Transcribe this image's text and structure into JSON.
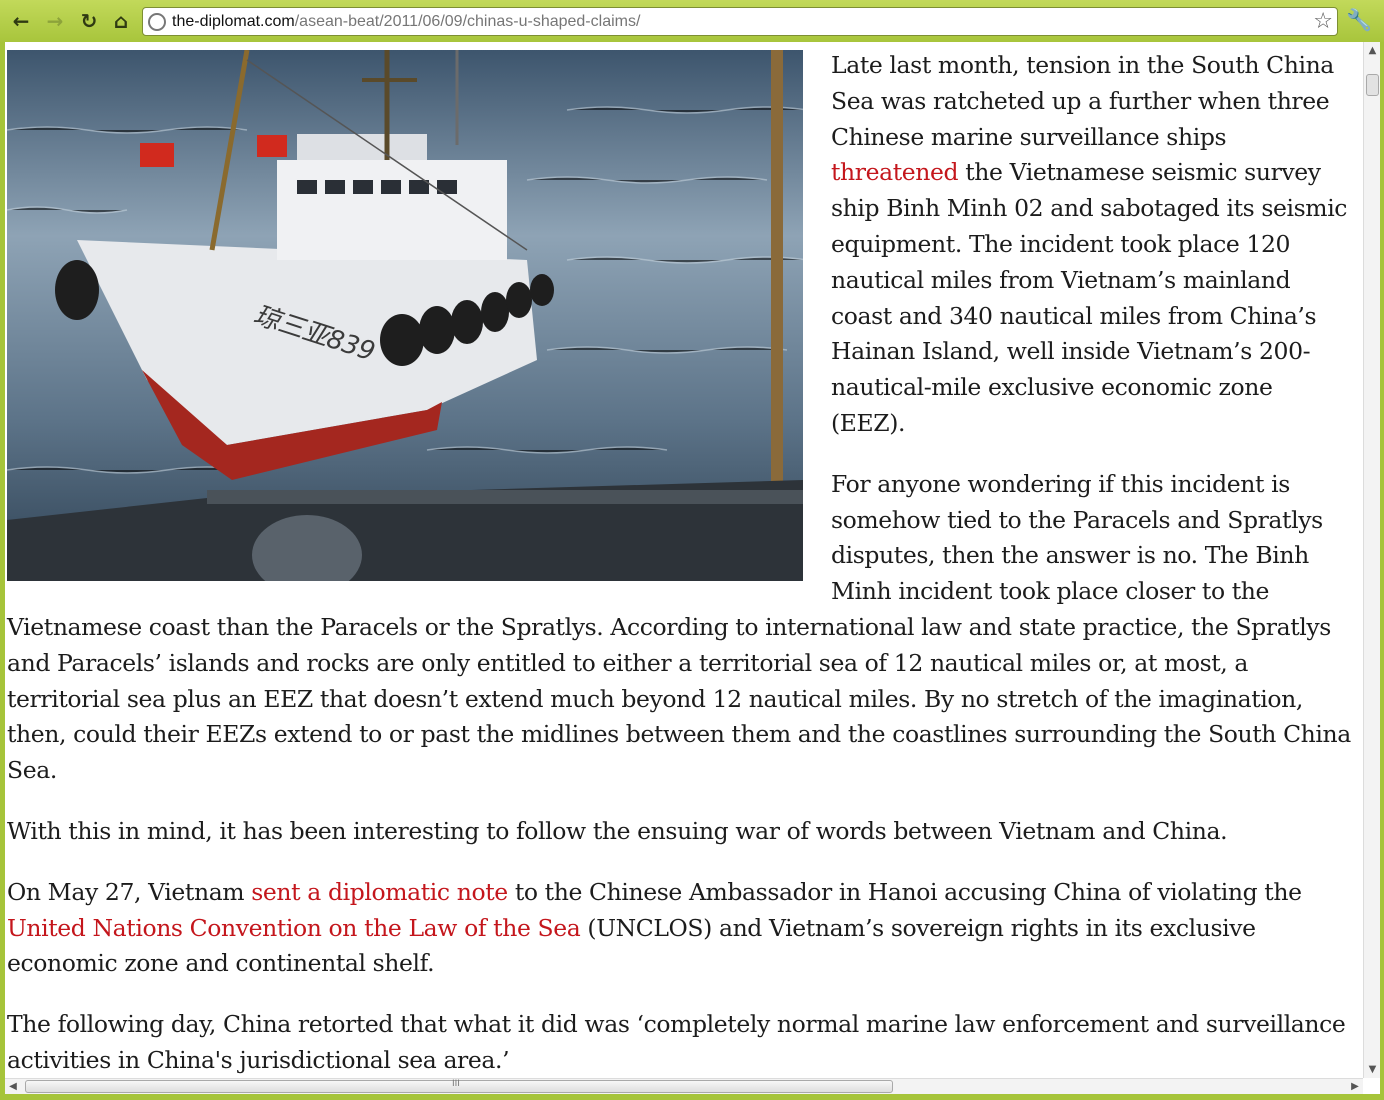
{
  "browser": {
    "url_host": "the-diplomat.com",
    "url_path": "/asean-beat/2011/06/09/chinas-u-shaped-claims/",
    "icons": [
      "back-arrow-icon",
      "forward-arrow-icon",
      "reload-icon",
      "home-icon",
      "globe-icon",
      "star-icon",
      "wrench-icon"
    ],
    "theme_color": "#a6c43a"
  },
  "article": {
    "p1": {
      "pre": "Late last month, tension in the South China Sea was ratcheted up a further when three Chinese marine surveillance ships ",
      "link": "threatened",
      "post": " the Vietnamese seismic survey ship Binh Minh 02 and sabotaged its seismic equipment. The incident took place 120 nautical miles from Vietnam’s mainland coast and 340 nautical miles from China’s Hainan Island, well inside Vietnam’s 200-nautical-mile exclusive economic zone (EEZ)."
    },
    "p2": "For anyone wondering if this incident is somehow tied to the Paracels and Spratlys disputes, then the answer is no. The Binh Minh incident took place closer to the Vietnamese coast than the Paracels or the Spratlys. According to international law and state practice, the Spratlys and Paracels’ islands and rocks are only entitled to either a territorial sea of 12 nautical miles or, at most, a territorial sea plus an EEZ that doesn’t extend much beyond 12 nautical miles. By no stretch of the imagination, then, could their EEZs extend to or past the midlines between them and the coastlines surrounding the South China Sea.",
    "p3": "With this in mind, it has been interesting to follow the ensuing war of words between Vietnam and China.",
    "p4": {
      "pre": "On May 27, Vietnam ",
      "link1": "sent a diplomatic note",
      "mid": " to the Chinese Ambassador in Hanoi accusing China of violating the ",
      "link2": "United Nations Convention on the Law of the Sea",
      "post": " (UNCLOS) and Vietnam’s sovereign rights in its exclusive economic zone and continental shelf."
    },
    "p5": "The following day, China retorted that what it did was ‘completely normal marine law enforcement and surveillance activities in China's jurisdictional sea area.’",
    "link_color": "#c4161c",
    "photo": {
      "hull_text": "琼三亚839"
    }
  }
}
